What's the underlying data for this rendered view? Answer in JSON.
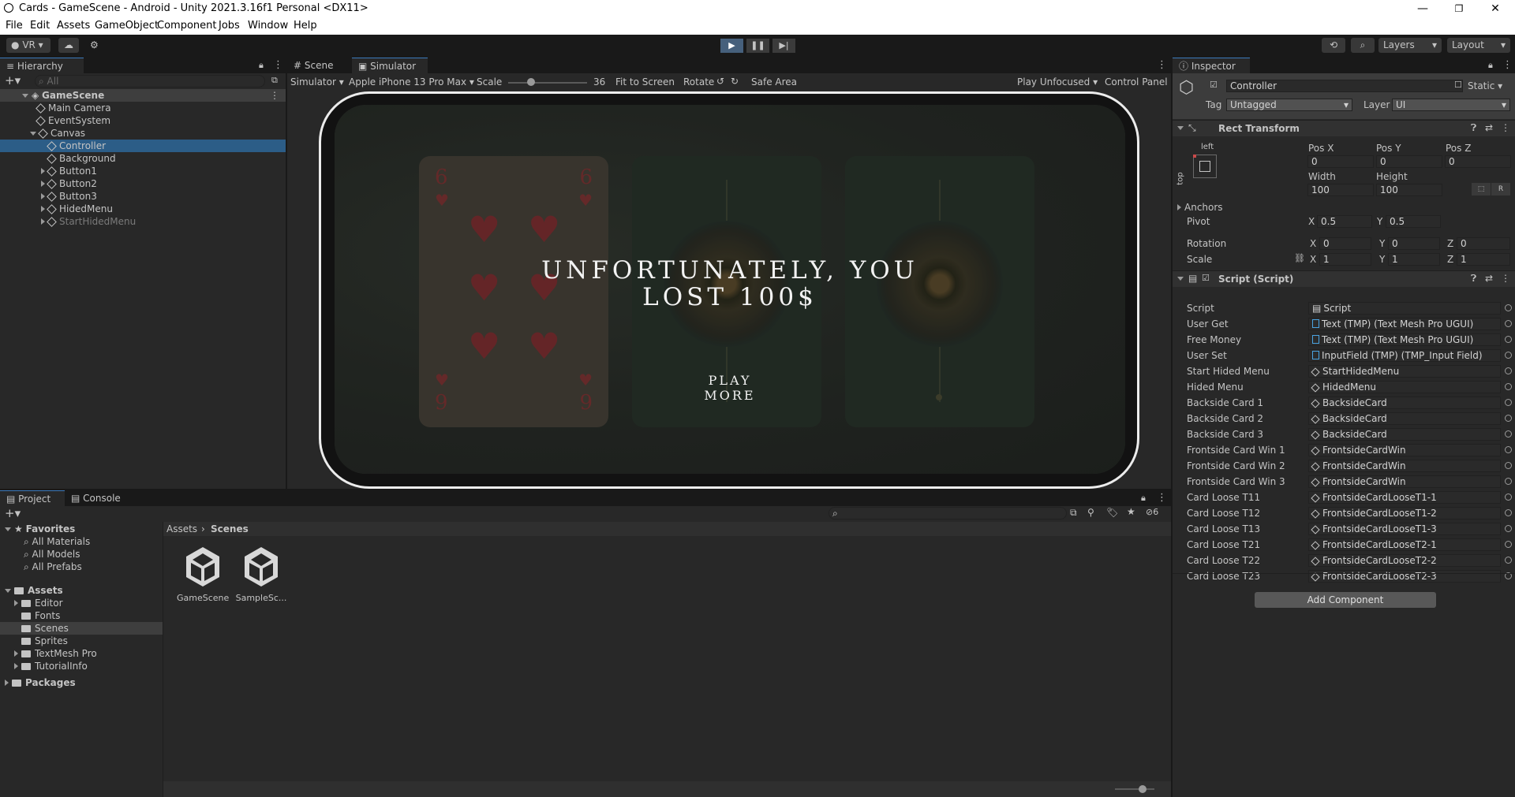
{
  "window": {
    "title": "Cards - GameScene - Android - Unity 2021.3.16f1 Personal <DX11>",
    "controls": [
      "—",
      "❐",
      "✕"
    ]
  },
  "menu": [
    "File",
    "Edit",
    "Assets",
    "GameObject",
    "Component",
    "Jobs",
    "Window",
    "Help"
  ],
  "toolbar": {
    "account": "VR",
    "layers": "Layers",
    "layout": "Layout"
  },
  "hierarchy": {
    "tab": "Hierarchy",
    "search_placeholder": "All",
    "scene": "GameScene",
    "items": [
      {
        "label": "Main Camera",
        "indent": 1
      },
      {
        "label": "EventSystem",
        "indent": 1
      },
      {
        "label": "Canvas",
        "indent": 1,
        "expanded": true
      },
      {
        "label": "Controller",
        "indent": 2,
        "selected": true
      },
      {
        "label": "Background",
        "indent": 2
      },
      {
        "label": "Button1",
        "indent": 2,
        "collapsed": true
      },
      {
        "label": "Button2",
        "indent": 2,
        "collapsed": true
      },
      {
        "label": "Button3",
        "indent": 2,
        "collapsed": true
      },
      {
        "label": "HidedMenu",
        "indent": 2,
        "collapsed": true
      },
      {
        "label": "StartHidedMenu",
        "indent": 2,
        "collapsed": true,
        "inactive": true
      }
    ]
  },
  "viewtabs": {
    "scene": "Scene",
    "simulator": "Simulator"
  },
  "simulator_bar": {
    "mode": "Simulator",
    "device": "Apple iPhone 13 Pro Max",
    "scale_label": "Scale",
    "scale_value": "36",
    "fit": "Fit to Screen",
    "rotate": "Rotate",
    "safe_area": "Safe Area",
    "play_mode": "Play Unfocused",
    "control_panel": "Control Panel"
  },
  "game": {
    "message_line1": "UNFORTUNATELY, YOU",
    "message_line2": "LOST 100$",
    "button_line1": "PLAY",
    "button_line2": "MORE",
    "card_rank": "6",
    "card_rank_bottom": "9"
  },
  "bottom": {
    "project_tab": "Project",
    "console_tab": "Console",
    "hidden_count": "6",
    "favorites": "Favorites",
    "favorites_items": [
      "All Materials",
      "All Models",
      "All Prefabs"
    ],
    "assets": "Assets",
    "asset_folders": [
      "Editor",
      "Fonts",
      "Scenes",
      "Sprites",
      "TextMesh Pro",
      "TutorialInfo"
    ],
    "packages": "Packages",
    "breadcrumb": [
      "Assets",
      "Scenes"
    ],
    "files": [
      "GameScene",
      "SampleSc..."
    ]
  },
  "inspector": {
    "tab": "Inspector",
    "object_name": "Controller",
    "static_label": "Static",
    "tag_label": "Tag",
    "tag_value": "Untagged",
    "layer_label": "Layer",
    "layer_value": "UI",
    "rect": {
      "title": "Rect Transform",
      "anchor_h": "left",
      "anchor_v": "top",
      "pos_x_label": "Pos X",
      "pos_y_label": "Pos Y",
      "pos_z_label": "Pos Z",
      "pos_x": "0",
      "pos_y": "0",
      "pos_z": "0",
      "width_label": "Width",
      "height_label": "Height",
      "width": "100",
      "height": "100",
      "r_label": "R",
      "anchors_label": "Anchors",
      "pivot_label": "Pivot",
      "pivot_x": "0.5",
      "pivot_y": "0.5",
      "rotation_label": "Rotation",
      "rot_x": "0",
      "rot_y": "0",
      "rot_z": "0",
      "scale_label": "Scale",
      "scale_x": "1",
      "scale_y": "1",
      "scale_z": "1",
      "x": "X",
      "y": "Y",
      "z": "Z"
    },
    "script": {
      "title": "Script (Script)",
      "fields": [
        {
          "label": "Script",
          "value": "Script",
          "kind": "script"
        },
        {
          "label": "User Get",
          "value": "Text (TMP) (Text Mesh Pro UGUI)",
          "kind": "tmp"
        },
        {
          "label": "Free Money",
          "value": "Text (TMP) (Text Mesh Pro UGUI)",
          "kind": "tmp"
        },
        {
          "label": "User Set",
          "value": "InputField (TMP) (TMP_Input Field)",
          "kind": "tmp"
        },
        {
          "label": "Start Hided Menu",
          "value": "StartHidedMenu",
          "kind": "go"
        },
        {
          "label": "Hided Menu",
          "value": "HidedMenu",
          "kind": "go"
        },
        {
          "label": "Backside Card 1",
          "value": "BacksideCard",
          "kind": "go"
        },
        {
          "label": "Backside Card 2",
          "value": "BacksideCard",
          "kind": "go"
        },
        {
          "label": "Backside Card 3",
          "value": "BacksideCard",
          "kind": "go"
        },
        {
          "label": "Frontside Card Win 1",
          "value": "FrontsideCardWin",
          "kind": "go"
        },
        {
          "label": "Frontside Card Win 2",
          "value": "FrontsideCardWin",
          "kind": "go"
        },
        {
          "label": "Frontside Card Win 3",
          "value": "FrontsideCardWin",
          "kind": "go"
        },
        {
          "label": "Card Loose T11",
          "value": "FrontsideCardLooseT1-1",
          "kind": "go"
        },
        {
          "label": "Card Loose T12",
          "value": "FrontsideCardLooseT1-2",
          "kind": "go"
        },
        {
          "label": "Card Loose T13",
          "value": "FrontsideCardLooseT1-3",
          "kind": "go"
        },
        {
          "label": "Card Loose T21",
          "value": "FrontsideCardLooseT2-1",
          "kind": "go"
        },
        {
          "label": "Card Loose T22",
          "value": "FrontsideCardLooseT2-2",
          "kind": "go"
        },
        {
          "label": "Card Loose T23",
          "value": "FrontsideCardLooseT2-3",
          "kind": "go"
        }
      ]
    },
    "add_component": "Add Component"
  },
  "colors": {
    "selection": "#2c5d87",
    "panel": "#282828",
    "accent": "#46607c",
    "card_heart": "#8a3a3a"
  }
}
